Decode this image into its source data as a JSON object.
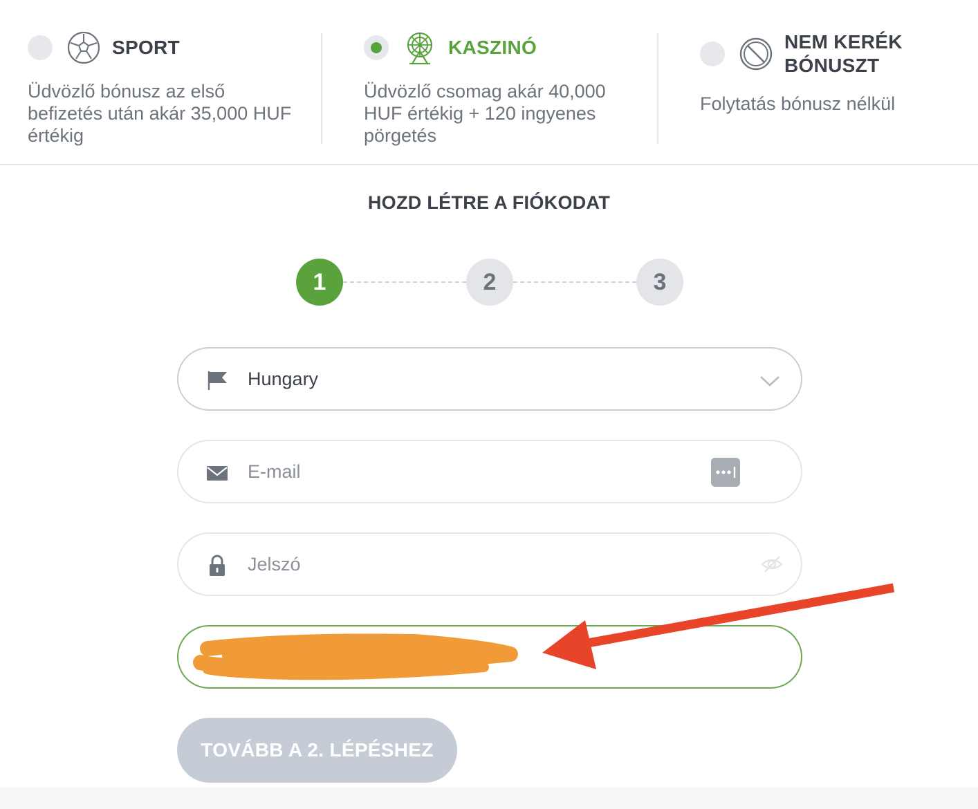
{
  "bonuses": [
    {
      "title": "SPORT",
      "description": "Üdvözlő bónusz az első befizetés után akár 35,000 HUF értékig",
      "icon": "soccer-ball-icon",
      "selected": false
    },
    {
      "title": "KASZINÓ",
      "description": "Üdvözlő csomag akár 40,000 HUF értékig + 120 ingyenes pörgetés",
      "icon": "wheel-of-fortune-icon",
      "selected": true
    },
    {
      "title": "NEM KERÉK BÓNUSZT",
      "description": "Folytatás bónusz nélkül",
      "icon": "no-entry-icon",
      "selected": false
    }
  ],
  "form": {
    "title": "HOZD LÉTRE A FIÓKODAT",
    "steps": [
      "1",
      "2",
      "3"
    ],
    "active_step": "1",
    "country": {
      "value": "Hungary",
      "icon": "flag-icon"
    },
    "email": {
      "placeholder": "E-mail",
      "icon": "envelope-icon"
    },
    "password": {
      "placeholder": "Jelszó",
      "icon": "lock-icon"
    },
    "next_button": "TOVÁBB A 2. LÉPÉSHEZ"
  },
  "colors": {
    "accent_green": "#5aa23c",
    "annotation_arrow": "#e8442a",
    "redaction_scribble": "#f09a38",
    "button_disabled": "#c5ccd6"
  }
}
